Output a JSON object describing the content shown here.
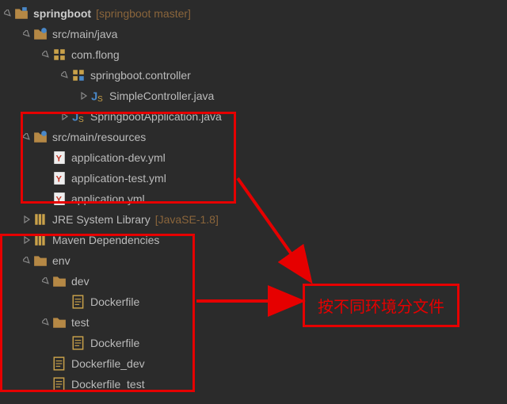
{
  "tree": {
    "root": {
      "label": "springboot",
      "suffix": "[springboot master]"
    },
    "srcMainJava": {
      "label": "src/main/java"
    },
    "comFlong": {
      "label": "com.flong"
    },
    "controller": {
      "label": "springboot.controller"
    },
    "simpleController": {
      "label": "SimpleController.java"
    },
    "springbootApp": {
      "label": "SpringbootApplication.java"
    },
    "srcMainResources": {
      "label": "src/main/resources"
    },
    "appDevYml": {
      "label": "application-dev.yml"
    },
    "appTestYml": {
      "label": "application-test.yml"
    },
    "appYml": {
      "label": "application.yml"
    },
    "jre": {
      "label": "JRE System Library",
      "suffix": "[JavaSE-1.8]"
    },
    "maven": {
      "label": "Maven Dependencies"
    },
    "env": {
      "label": "env"
    },
    "dev": {
      "label": "dev"
    },
    "devDockerfile": {
      "label": "Dockerfile"
    },
    "test": {
      "label": "test"
    },
    "testDockerfile": {
      "label": "Dockerfile"
    },
    "dockerfileDev": {
      "label": "Dockerfile_dev"
    },
    "dockerfileTest": {
      "label": "Dockerfile_test"
    }
  },
  "callout": "按不同环境分文件"
}
